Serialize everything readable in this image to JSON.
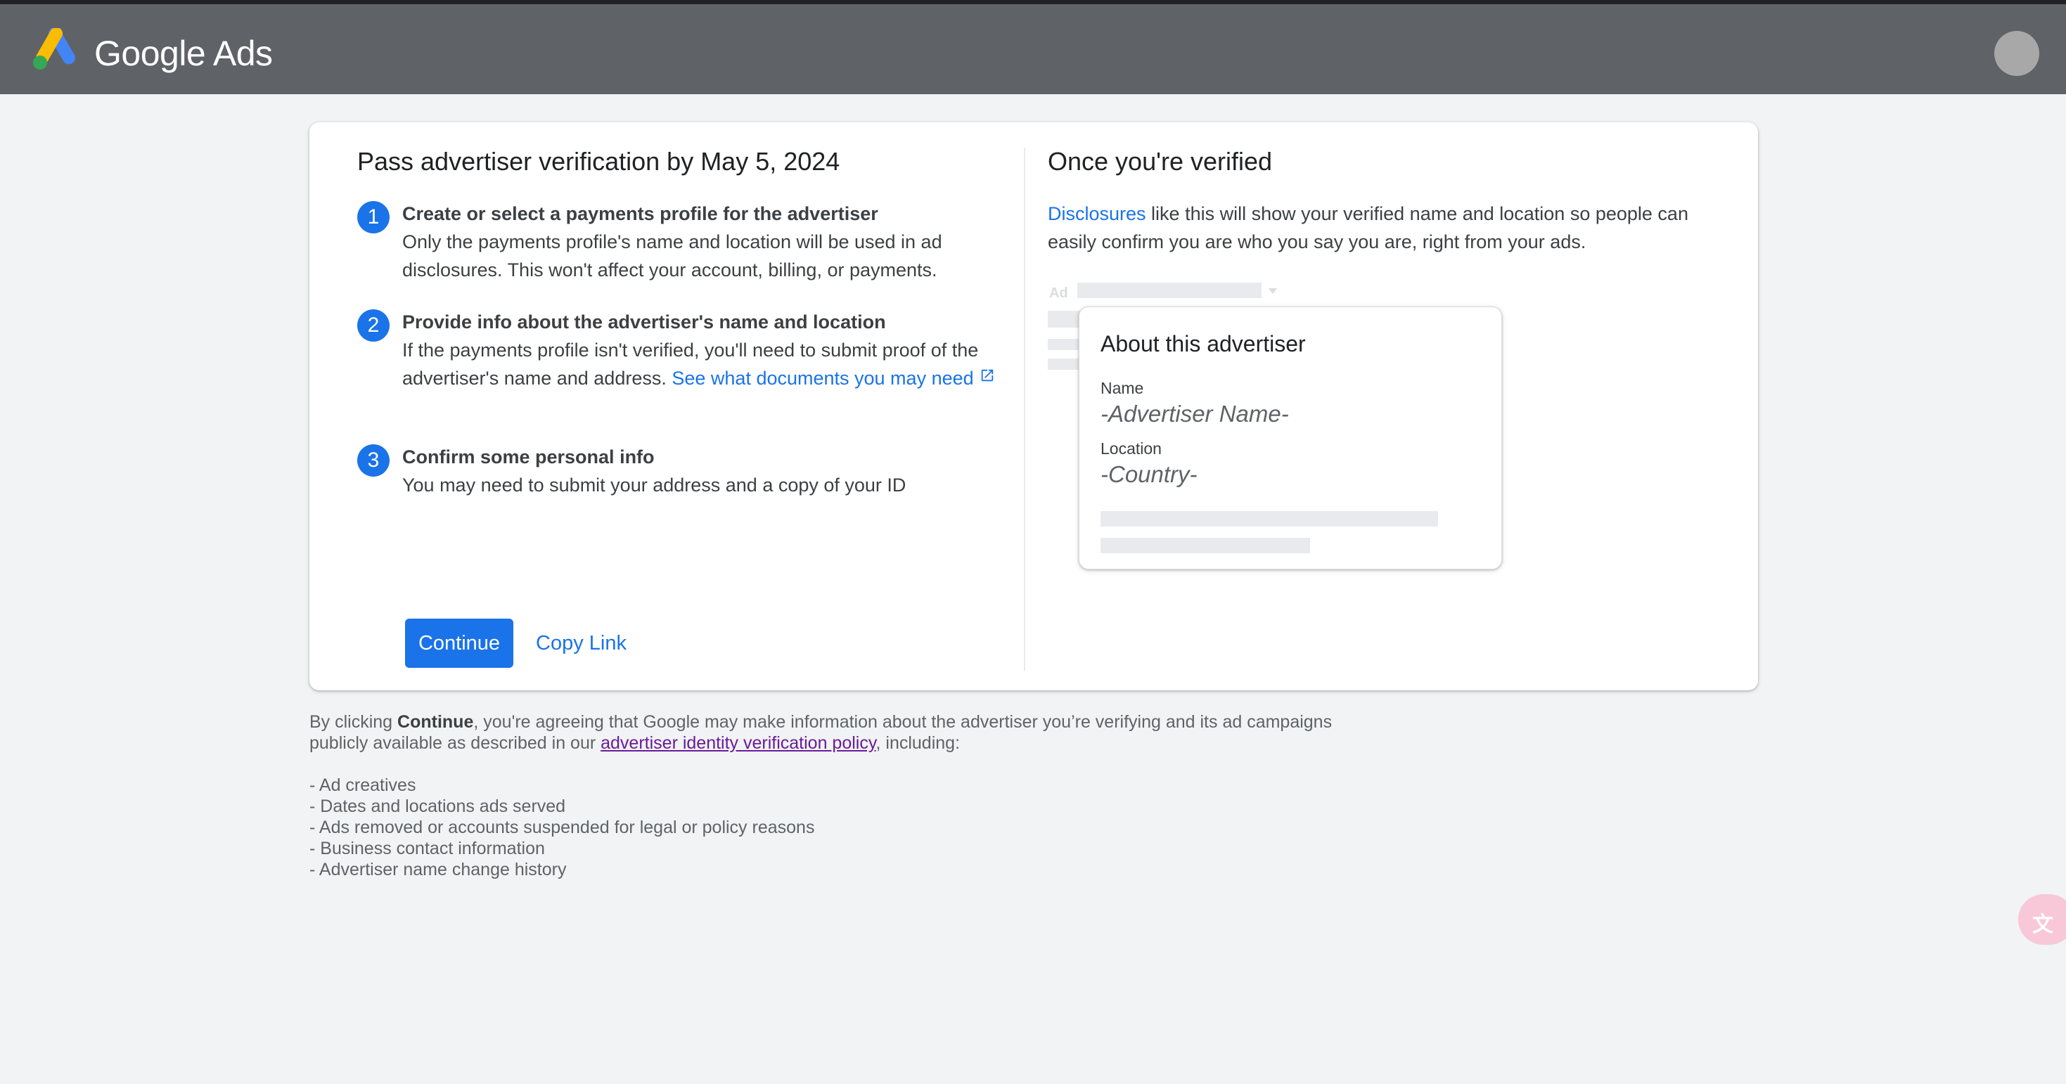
{
  "header": {
    "brand": "Google Ads",
    "brand_colors": {
      "blue": "#4285f4",
      "yellow": "#fbbc04",
      "green": "#34a853"
    }
  },
  "left_panel": {
    "title": "Pass advertiser verification by May 5, 2024",
    "steps": [
      {
        "number": "1",
        "title": "Create or select a payments profile for the advertiser",
        "body": "Only the payments profile's name and location will be used in ad disclosures. This won't affect your account, billing, or payments."
      },
      {
        "number": "2",
        "title": "Provide info about the advertiser's name and location",
        "body": "If the payments profile isn't verified, you'll need to submit proof of the advertiser's name and address.",
        "link": "See what documents you may need"
      },
      {
        "number": "3",
        "title": "Confirm some personal info",
        "body": "You may need to submit your address and a copy of your ID"
      }
    ],
    "continue_label": "Continue",
    "copy_link_label": "Copy Link"
  },
  "right_panel": {
    "title": "Once you're verified",
    "disclosures_link": "Disclosures",
    "disclosures_text": " like this will show your verified name and location so people can easily confirm you are who you say you are, right from your ads.",
    "ad_label": "Ad",
    "about_card": {
      "title": "About this advertiser",
      "name_label": "Name",
      "name_value": "-Advertiser Name-",
      "location_label": "Location",
      "location_value": "-Country-"
    }
  },
  "consent": {
    "prefix": "By clicking ",
    "bold": "Continue",
    "middle": ", you're agreeing that Google may make information about the advertiser you’re verifying and its ad campaigns publicly available as described in our ",
    "policy_link": "advertiser identity verification policy",
    "suffix": ", including:",
    "items": [
      "- Ad creatives",
      "- Dates and locations ads served",
      "- Ads removed or accounts suspended for legal or policy reasons",
      "- Business contact information",
      "- Advertiser name change history"
    ]
  },
  "floating": {
    "translate_icon": "translate-icon"
  }
}
